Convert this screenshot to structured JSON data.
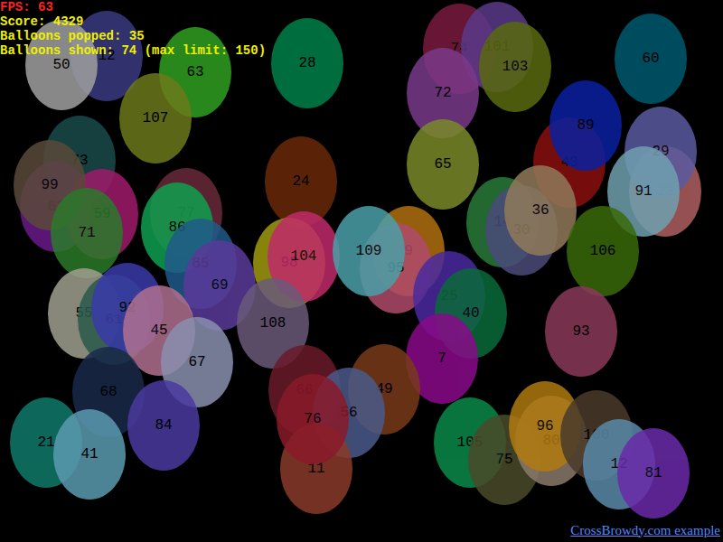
{
  "hud": [
    {
      "text": "FPS: 63",
      "color": "#ff2020"
    },
    {
      "text": "Score: 4329",
      "color": "#f0f000"
    },
    {
      "text": "Balloons popped: 35",
      "color": "#f0f000"
    },
    {
      "text": "Balloons shown: 74 (max limit: 150)",
      "color": "#f0f000"
    }
  ],
  "balloons": [
    {
      "label": "12",
      "color": "#3a3a80"
    },
    {
      "label": "50",
      "color": "#a0a0a0"
    },
    {
      "label": "63",
      "color": "#30a020"
    },
    {
      "label": "28",
      "color": "#00804a"
    },
    {
      "label": "107",
      "color": "#6b7a1a"
    },
    {
      "label": "74",
      "color": "#7a1a40"
    },
    {
      "label": "101",
      "color": "#5a3a8a"
    },
    {
      "label": "103",
      "color": "#5a6a10"
    },
    {
      "label": "72",
      "color": "#7a3a8a"
    },
    {
      "label": "60",
      "color": "#005a70"
    },
    {
      "label": "43",
      "color": "#8a1010"
    },
    {
      "label": "89",
      "color": "#0a20a0"
    },
    {
      "label": "23",
      "color": "#b06060"
    },
    {
      "label": "29",
      "color": "#5a5aa0"
    },
    {
      "label": "91",
      "color": "#70a0b0"
    },
    {
      "label": "65",
      "color": "#7a8a2a"
    },
    {
      "label": "24",
      "color": "#6a2a0a"
    },
    {
      "label": "73",
      "color": "#1a4a4a"
    },
    {
      "label": "62",
      "color": "#6a1a8a"
    },
    {
      "label": "59",
      "color": "#a01a6a"
    },
    {
      "label": "99",
      "color": "#5a4a3a"
    },
    {
      "label": "71",
      "color": "#2a7a2a"
    },
    {
      "label": "77",
      "color": "#6a2a3a"
    },
    {
      "label": "86",
      "color": "#10a050"
    },
    {
      "label": "85",
      "color": "#205a8a"
    },
    {
      "label": "69",
      "color": "#5a3a9a"
    },
    {
      "label": "98",
      "color": "#a09a10"
    },
    {
      "label": "104",
      "color": "#c02a6a"
    },
    {
      "label": "9",
      "color": "#b07010"
    },
    {
      "label": "95",
      "color": "#b04a6a"
    },
    {
      "label": "109",
      "color": "#4aa0a8"
    },
    {
      "label": "14",
      "color": "#2a7a3a"
    },
    {
      "label": "30",
      "color": "#4a4a7a"
    },
    {
      "label": "36",
      "color": "#907a5a"
    },
    {
      "label": "106",
      "color": "#3a6a0a"
    },
    {
      "label": "25",
      "color": "#4a2aa0"
    },
    {
      "label": "40",
      "color": "#0a6a3a"
    },
    {
      "label": "55",
      "color": "#a0a090"
    },
    {
      "label": "61",
      "color": "#2a5a4a"
    },
    {
      "label": "92",
      "color": "#3a3aaa"
    },
    {
      "label": "45",
      "color": "#b07090"
    },
    {
      "label": "67",
      "color": "#8a90b0"
    },
    {
      "label": "108",
      "color": "#6a5a7a"
    },
    {
      "label": "93",
      "color": "#8a3a5a"
    },
    {
      "label": "7",
      "color": "#8a0a8a"
    },
    {
      "label": "68",
      "color": "#1a2a4a"
    },
    {
      "label": "66",
      "color": "#6a1a2a"
    },
    {
      "label": "49",
      "color": "#7a3a1a"
    },
    {
      "label": "56",
      "color": "#4a5a8a"
    },
    {
      "label": "11",
      "color": "#8a3a2a"
    },
    {
      "label": "76",
      "color": "#8a1a2a"
    },
    {
      "label": "84",
      "color": "#4a3aa0"
    },
    {
      "label": "21",
      "color": "#107a6a"
    },
    {
      "label": "41",
      "color": "#5a9ab0"
    },
    {
      "label": "105",
      "color": "#0a8a4a"
    },
    {
      "label": "75",
      "color": "#4a4a2a"
    },
    {
      "label": "80",
      "color": "#8a7a6a"
    },
    {
      "label": "96",
      "color": "#b07a10"
    },
    {
      "label": "100",
      "color": "#4a3a2a"
    },
    {
      "label": "12",
      "color": "#5a8aaa"
    },
    {
      "label": "81",
      "color": "#6a2aaa"
    }
  ],
  "footer_link": "CrossBrowdy.com example"
}
